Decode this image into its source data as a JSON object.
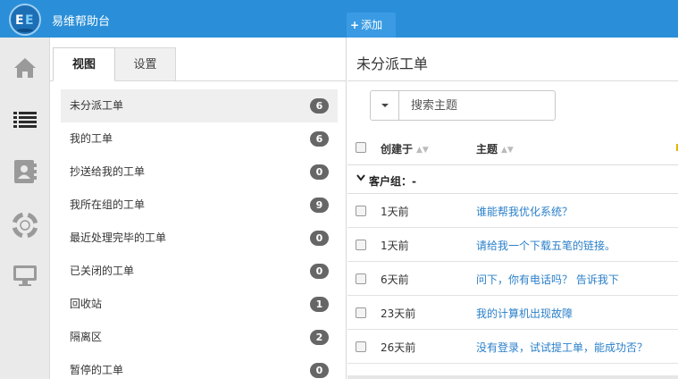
{
  "app": {
    "title": "易维帮助台",
    "add_button": "添加"
  },
  "tabs": [
    {
      "label": "视图"
    },
    {
      "label": "设置"
    }
  ],
  "views": [
    {
      "label": "未分派工单",
      "count": "6"
    },
    {
      "label": "我的工单",
      "count": "6"
    },
    {
      "label": "抄送给我的工单",
      "count": "0"
    },
    {
      "label": "我所在组的工单",
      "count": "9"
    },
    {
      "label": "最近处理完毕的工单",
      "count": "0"
    },
    {
      "label": "已关闭的工单",
      "count": "0"
    },
    {
      "label": "回收站",
      "count": "1"
    },
    {
      "label": "隔离区",
      "count": "2"
    },
    {
      "label": "暂停的工单",
      "count": "0"
    }
  ],
  "main": {
    "title": "未分派工单",
    "search_placeholder": "搜索主题",
    "columns": {
      "created": "创建于",
      "subject": "主题"
    },
    "group_label": "客户组：-",
    "rows": [
      {
        "created": "1天前",
        "subject": "谁能帮我优化系统？"
      },
      {
        "created": "1天前",
        "subject": "请给我一个下载五笔的链接。"
      },
      {
        "created": "6天前",
        "subject": "问下，你有电话吗？ 告诉我下"
      },
      {
        "created": "23天前",
        "subject": "我的计算机出现故障"
      },
      {
        "created": "26天前",
        "subject": "没有登录，试试提工单，能成功否？"
      }
    ]
  },
  "colors": {
    "brand": "#2a8fd8",
    "link": "#2a7fc9",
    "badge": "#666666"
  },
  "icons": [
    "app-logo",
    "home-icon",
    "list-icon",
    "contacts-icon",
    "help-lifebuoy-icon",
    "monitor-icon",
    "plus-icon",
    "chevron-down-icon"
  ]
}
